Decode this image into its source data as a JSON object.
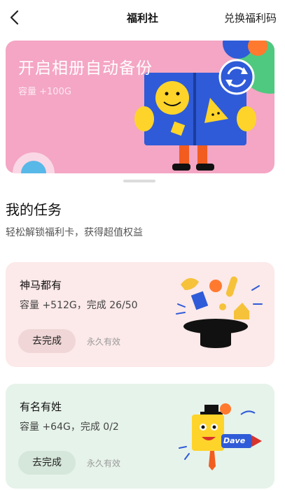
{
  "header": {
    "title": "福利社",
    "redeem_label": "兑换福利码"
  },
  "banner": {
    "title": "开启相册自动备份",
    "subtitle": "容量 +100G"
  },
  "tasks_section": {
    "title": "我的任务",
    "subtitle": "轻松解锁福利卡，获得超值权益"
  },
  "tasks": [
    {
      "name": "神马都有",
      "description": "容量 +512G，完成 26/50",
      "action_label": "去完成",
      "validity": "永久有效"
    },
    {
      "name": "有名有姓",
      "description": "容量 +64G，完成 0/2",
      "action_label": "去完成",
      "validity": "永久有效"
    }
  ],
  "illustration_text": {
    "name_tag": "Dave"
  },
  "colors": {
    "banner_bg": "#f4a6c4",
    "task1_bg": "#fce9e9",
    "task2_bg": "#e6f3ea",
    "accent_blue": "#2f5bd8",
    "accent_yellow": "#ffd42a"
  }
}
